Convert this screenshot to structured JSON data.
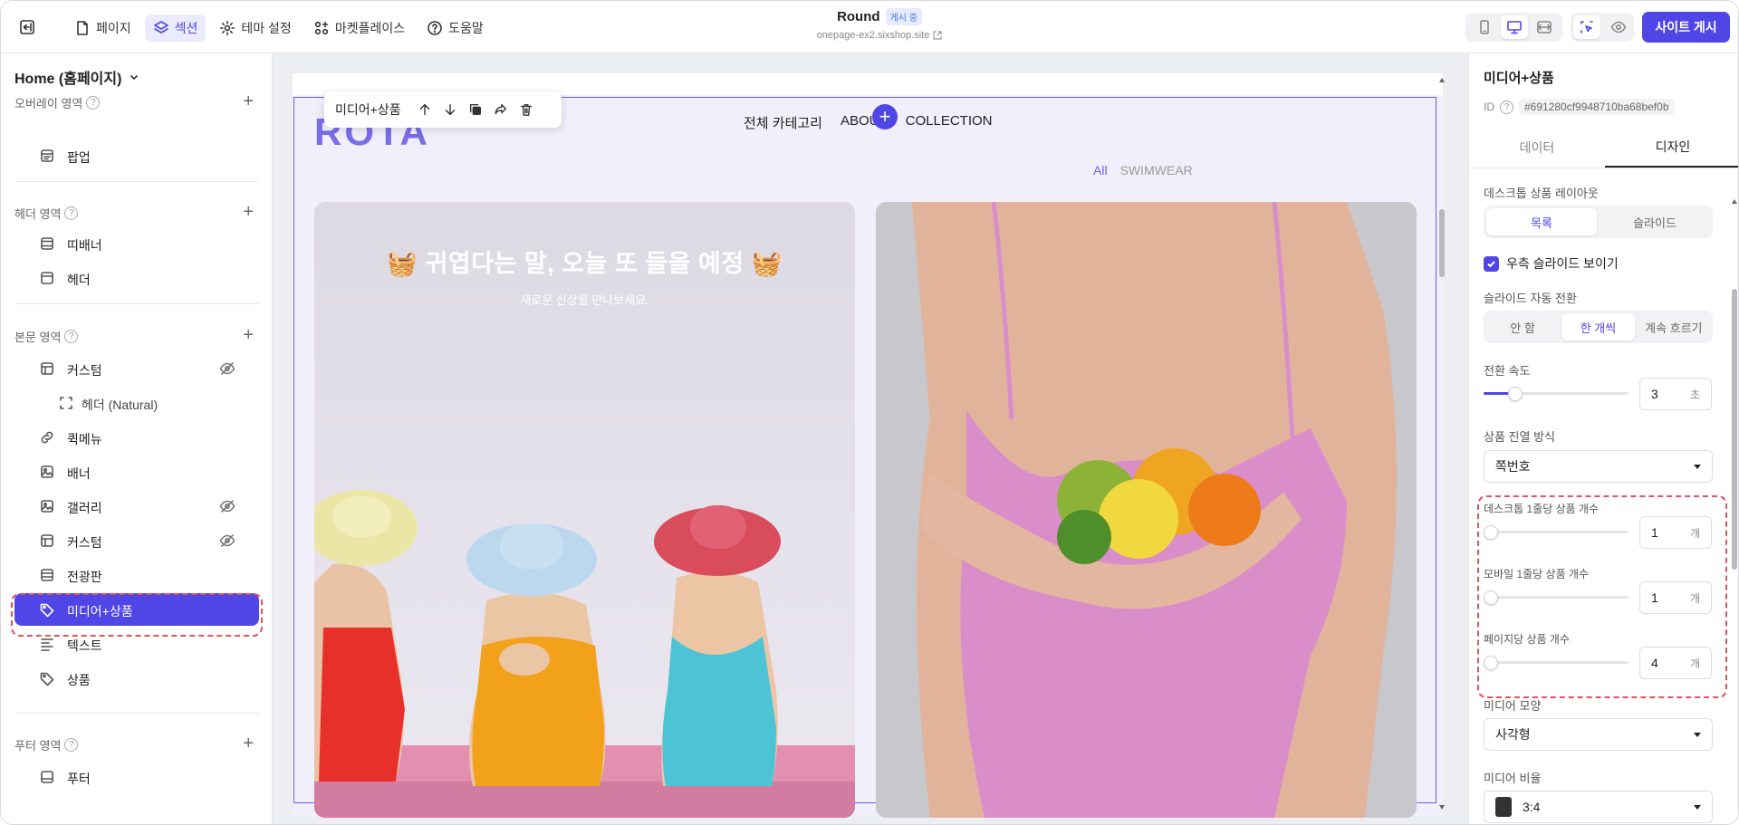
{
  "topbar": {
    "nav": [
      {
        "label": "페이지",
        "icon": "page-icon"
      },
      {
        "label": "섹션",
        "icon": "layers-icon"
      },
      {
        "label": "테마 설정",
        "icon": "gear-icon"
      },
      {
        "label": "마켓플레이스",
        "icon": "apps-icon"
      },
      {
        "label": "도움말",
        "icon": "help-icon"
      }
    ],
    "active_nav": "섹션",
    "site_title": "Round",
    "status_badge": "게시 중",
    "site_url": "onepage-ex2.sixshop.site",
    "publish_label": "사이트 게시",
    "accent": "#5046e5"
  },
  "left": {
    "page_selector": "Home (홈페이지)",
    "groups": {
      "overlay": "오버레이 영역",
      "header": "헤더 영역",
      "body": "본문 영역",
      "footer": "푸터 영역"
    },
    "items": {
      "popup": "팝업",
      "topbanner": "띠배너",
      "header": "헤더",
      "custom1": "커스텀",
      "header_natural": "헤더 (Natural)",
      "quickmenu": "퀵메뉴",
      "banner": "배너",
      "gallery": "갤러리",
      "custom2": "커스텀",
      "billboard": "전광판",
      "media_product": "미디어+상품",
      "text": "텍스트",
      "product": "상품",
      "footer": "푸터"
    },
    "selected": "미디어+상품"
  },
  "canvas": {
    "toolbar_label": "미디어+상품",
    "logo": "ROTA",
    "menu": [
      "전체 카테고리",
      "ABOUT",
      "COLLECTION"
    ],
    "filters": {
      "all": "All",
      "swimwear": "SWIMWEAR"
    },
    "card1": {
      "headline": "🧺 귀엽다는 말, 오늘 또 들을 예정 🧺",
      "sub": "새로운 신상을 만나보세요."
    }
  },
  "right": {
    "title": "미디어+상품",
    "id_label": "ID",
    "id_value": "#691280cf9948710ba68bef0b",
    "tabs": [
      "데이터",
      "디자인"
    ],
    "active_tab": "디자인",
    "desktop_layout": {
      "label": "데스크톱 상품 레이아웃",
      "options": [
        "목록",
        "슬라이드"
      ],
      "selected": "목록"
    },
    "show_right_slide": "우측 슬라이드 보이기",
    "auto_slide": {
      "label": "슬라이드 자동 전환",
      "options": [
        "안 함",
        "한 개씩",
        "계속 흐르기"
      ],
      "selected": "한 개씩"
    },
    "speed": {
      "label": "전환 속도",
      "value": "3",
      "unit": "초",
      "fraction": 0.22
    },
    "arrangement": {
      "label": "상품 진열 방식",
      "value": "쪽번호"
    },
    "desktop_per_row": {
      "label": "데스크톱 1줄당 상품 개수",
      "value": "1",
      "unit": "개",
      "fraction": 0
    },
    "mobile_per_row": {
      "label": "모바일 1줄당 상품 개수",
      "value": "1",
      "unit": "개",
      "fraction": 0
    },
    "per_page": {
      "label": "페이지당 상품 개수",
      "value": "4",
      "unit": "개",
      "fraction": 0.05
    },
    "media_shape": {
      "label": "미디어 모양",
      "value": "사각형"
    },
    "media_ratio": {
      "label": "미디어 비율",
      "value": "3:4"
    }
  }
}
